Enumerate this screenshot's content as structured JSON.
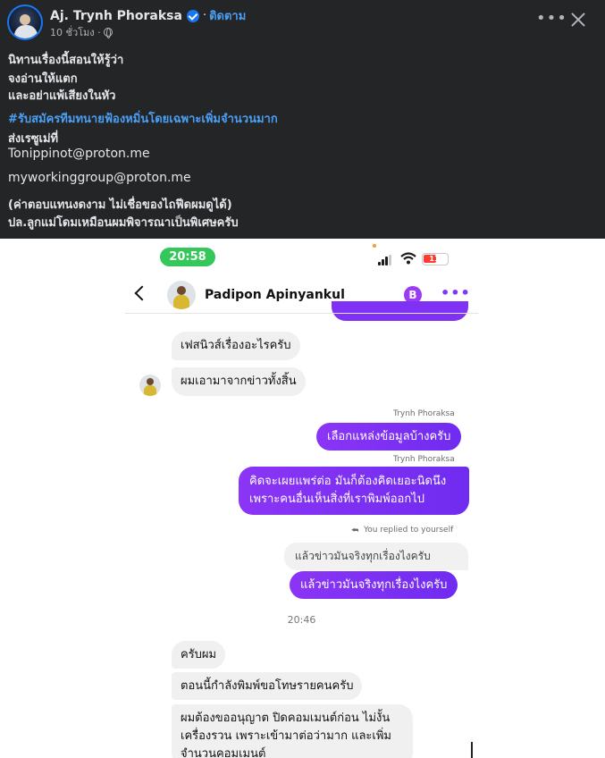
{
  "post": {
    "author": "Aj. Trynh Phoraksa",
    "separator": "·",
    "follow_label": "ติดตาม",
    "time": "10 ชั่วโมง ·",
    "lines": [
      "นิทานเรื่องนี้สอนให้รู้ว่า",
      "จงอ่านให้แตก",
      "และอย่าแพ้เสียงในหัว"
    ],
    "hashtag": "#รับสมัครทีมทนายฟ้องหมิ่นโดยเฉพาะเพิ่มจำนวนมาก",
    "send_label": "ส่งเรซูเม่ที่",
    "email1": "Tonippinot@proton.me",
    "email2": "myworkinggroup@proton.me",
    "note1": "(ค่าตอบแทนงดงาม ไม่เชื่อของไถฟีดผมดูได้)",
    "note2": "ปล.ลูกแม่โดมเหมือนผมพิจารณาเป็นพิเศษครับ"
  },
  "chat": {
    "status_time": "20:58",
    "battery": "11",
    "contact_name": "Padipon Apinyankul",
    "brand_badge": "B",
    "more_label": "•••",
    "messages": {
      "in1": "เฟสนิวส์เรื่องอะไรครับ",
      "in2": "ผมเอามาจากข่าวทั้งสิ้น",
      "sender_name": "Trynh Phoraksa",
      "out1": "เลือกแหล่งข้อมูลบ้างครับ",
      "out2_line1": "คิดจะเผยแพร่ต่อ มันก็ต้องคิดเยอะนิดนึง",
      "out2_line2": "เพราะคนอื่นเห็นสิ่งที่เราพิมพ์ออกไป",
      "reply_note": "You replied to yourself",
      "quoted": "แล้วข่าวมันจริงทุกเรื่องไงครับ",
      "out3": "แล้วข่าวมันจริงทุกเรื่องไงครับ",
      "time_divider": "20:46",
      "in3": "ครับผม",
      "in4": "ตอนนี้กำลังพิมพ์ขอโทษรายคนครับ",
      "in5_line1": "ผมต้องขออนุญาต ปิดคอมเมนต์ก่อน ไม่งั้น",
      "in5_line2": "เครื่องรวน เพราะเข้ามาต่อว่ามาก และเพิ่ม",
      "in5_line3": "จำนวนคอมเมนต์"
    }
  },
  "colors": {
    "fb_background": "#242526",
    "fb_link": "#4a9ff5",
    "messenger_purple": "#7b2ff7",
    "status_green": "#34c759"
  }
}
